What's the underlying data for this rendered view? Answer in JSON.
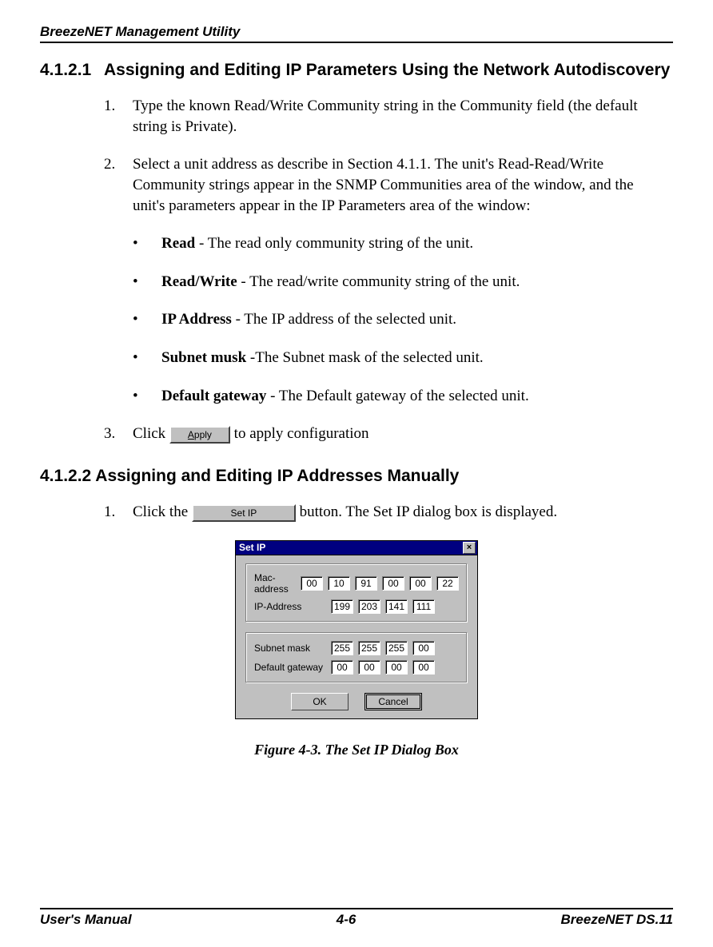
{
  "header": "BreezeNET Management Utility",
  "section1": {
    "num": "4.1.2.1",
    "title": "Assigning and Editing IP Parameters Using the Network Autodiscovery",
    "step1_num": "1.",
    "step1_text": "Type the known Read/Write Community string in the Community field (the default string is Private).",
    "step2_num": "2.",
    "step2_text": "Select a unit address as describe in Section 4.1.1. The unit's Read-Read/Write Community strings appear in the SNMP Communities area of the window, and the unit's parameters appear in the IP Parameters area of the window:",
    "bullets": [
      {
        "label": "Read",
        "text": " - The read only community string of the unit."
      },
      {
        "label": "Read/Write",
        "text": " - The read/write community string of the unit."
      },
      {
        "label": "IP Address",
        "text": " - The IP address of the selected unit."
      },
      {
        "label": "Subnet musk",
        "text": " -The Subnet mask of the selected unit."
      },
      {
        "label": "Default gateway",
        "text": " - The Default gateway of the selected unit."
      }
    ],
    "step3_num": "3.",
    "step3_pre": "Click ",
    "apply_btn": "Apply",
    "step3_post": " to apply configuration"
  },
  "section2": {
    "heading": "4.1.2.2  Assigning and Editing IP Addresses Manually",
    "step1_num": "1.",
    "step1_pre": "Click the ",
    "setip_btn": "Set IP",
    "step1_post": " button. The Set IP dialog box is displayed."
  },
  "dialog": {
    "title": "Set IP",
    "close": "×",
    "mac_label": "Mac-address",
    "mac": [
      "00",
      "10",
      "91",
      "00",
      "00",
      "22"
    ],
    "ip_label": "IP-Address",
    "ip": [
      "199",
      "203",
      "141",
      "111"
    ],
    "subnet_label": "Subnet mask",
    "subnet": [
      "255",
      "255",
      "255",
      "00"
    ],
    "gateway_label": "Default gateway",
    "gateway": [
      "00",
      "00",
      "00",
      "00"
    ],
    "ok": "OK",
    "cancel": "Cancel"
  },
  "figure_caption": "Figure 4-3.  The Set IP Dialog Box",
  "footer": {
    "left": "User's Manual",
    "center": "4-6",
    "right": "BreezeNET DS.11"
  }
}
